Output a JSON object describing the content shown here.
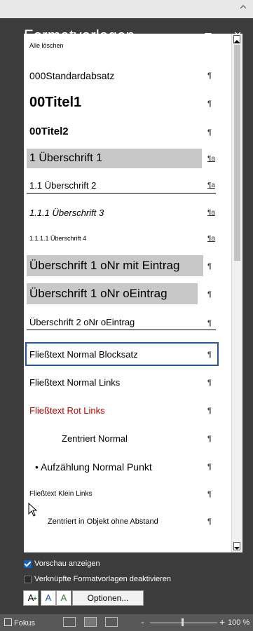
{
  "pane": {
    "title": "Formatvorlagen",
    "close_glyph": "×",
    "dropdown_icon": "triangle-down-icon"
  },
  "styles": [
    {
      "label": "Alle löschen",
      "mark": ""
    },
    {
      "label": "000Standardabsatz",
      "mark": "¶"
    },
    {
      "label": "00Titel1",
      "mark": "¶"
    },
    {
      "label": "00Titel2",
      "mark": "¶"
    },
    {
      "label": "1  Überschrift 1",
      "mark": "¶a"
    },
    {
      "label": "1.1  Überschrift 2",
      "mark": "¶a"
    },
    {
      "label": "1.1.1  Überschrift 3",
      "mark": "¶a"
    },
    {
      "label": "1.1.1.1  Überschrift 4",
      "mark": "¶a"
    },
    {
      "label": "Überschrift 1 oNr mit Eintrag",
      "mark": "¶"
    },
    {
      "label": "Überschrift 1 oNr oEintrag",
      "mark": "¶"
    },
    {
      "label": "Überschrift 2 oNr oEintrag",
      "mark": "¶"
    },
    {
      "label": "Fließtext Normal Blocksatz",
      "mark": "¶"
    },
    {
      "label": "Fließtext Normal Links",
      "mark": "¶"
    },
    {
      "label": "Fließtext Rot Links",
      "mark": "¶"
    },
    {
      "label": "Zentriert Normal",
      "mark": "¶"
    },
    {
      "label": "•  Aufzählung Normal Punkt",
      "mark": "¶"
    },
    {
      "label": "Fließtext Klein Links",
      "mark": "¶"
    },
    {
      "label": "Zentriert in Objekt ohne Abstand",
      "mark": "¶"
    }
  ],
  "options": {
    "preview_label": "Vorschau anzeigen",
    "preview_checked": true,
    "linked_label": "Verknüpfte Formatvorlagen deaktivieren",
    "linked_checked": false
  },
  "toolbar": {
    "new_style_glyph": "A",
    "new_style_sub": "+",
    "inspector_glyph": "A",
    "manage_glyph": "A",
    "options_label": "Optionen..."
  },
  "statusbar": {
    "focus_label": "Fokus",
    "zoom_out": "-",
    "zoom_in": "+",
    "zoom_label": "100 %"
  },
  "colors": {
    "pane_bg": "#3c3c3c",
    "selected_border": "#2b579a",
    "heading_highlight": "#c8c8c8",
    "red_text": "#c00000",
    "checkbox_blue": "#0f62c5"
  }
}
